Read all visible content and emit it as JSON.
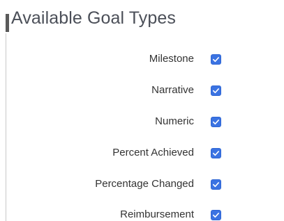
{
  "panel": {
    "title": "Available Goal Types"
  },
  "goal_types": [
    {
      "label": "Milestone",
      "checked": true
    },
    {
      "label": "Narrative",
      "checked": true
    },
    {
      "label": "Numeric",
      "checked": true
    },
    {
      "label": "Percent Achieved",
      "checked": true
    },
    {
      "label": "Percentage Changed",
      "checked": true
    },
    {
      "label": "Reimbursement",
      "checked": true
    }
  ],
  "colors": {
    "checkbox_fill": "#3b73e2",
    "title_text": "#4b4f58",
    "label_text": "#333333"
  }
}
